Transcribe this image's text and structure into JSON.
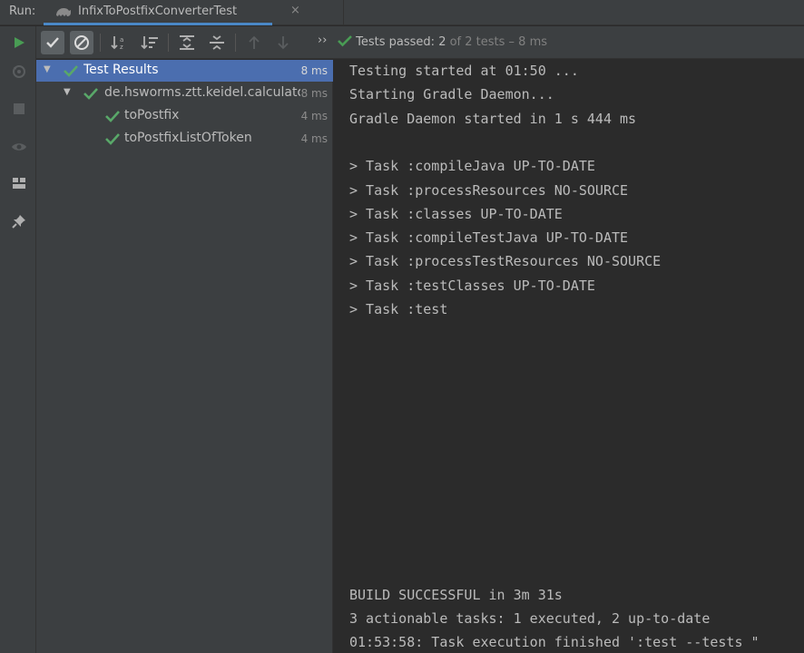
{
  "tabbar": {
    "run_label": "Run:",
    "tab_title": "InfixToPostfixConverterTest",
    "close_glyph": "×"
  },
  "toolbar": {
    "status_prefix": "Tests passed: ",
    "status_count": "2",
    "status_rest": " of 2 tests – 8 ms",
    "more_glyph": "››"
  },
  "tree": {
    "items": [
      {
        "label": "Test Results",
        "time": "8 ms"
      },
      {
        "label": "de.hsworms.ztt.keidel.calculator.I",
        "time": "8 ms"
      },
      {
        "label": "toPostfix",
        "time": "4 ms"
      },
      {
        "label": "toPostfixListOfToken",
        "time": "4 ms"
      }
    ]
  },
  "console": {
    "lines": [
      "Testing started at 01:50 ...",
      "Starting Gradle Daemon...",
      "Gradle Daemon started in 1 s 444 ms",
      "",
      "> Task :compileJava UP-TO-DATE",
      "> Task :processResources NO-SOURCE",
      "> Task :classes UP-TO-DATE",
      "> Task :compileTestJava UP-TO-DATE",
      "> Task :processTestResources NO-SOURCE",
      "> Task :testClasses UP-TO-DATE",
      "> Task :test"
    ],
    "footer_lines": [
      "BUILD SUCCESSFUL in 3m 31s",
      "3 actionable tasks: 1 executed, 2 up-to-date",
      "01:53:58: Task execution finished ':test --tests \""
    ]
  },
  "colors": {
    "accent": "#4a88c7",
    "selected_row": "#4b6eaf",
    "success_green": "#499c54",
    "panel_bg": "#3c3f41",
    "console_bg": "#2b2b2b"
  }
}
